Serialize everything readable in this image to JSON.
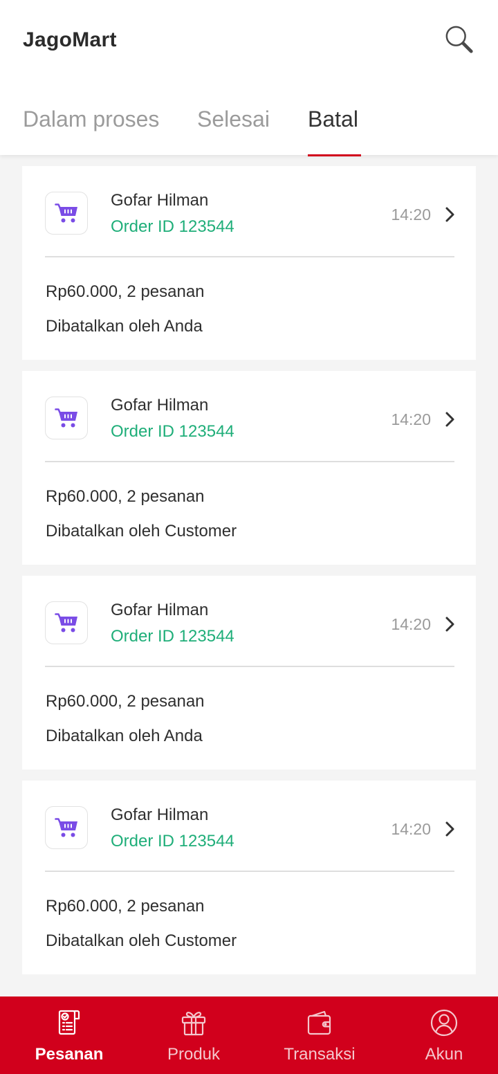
{
  "app": {
    "title": "JagoMart"
  },
  "header": {
    "search_icon": "search-icon"
  },
  "tabs": [
    {
      "label": "Dalam proses",
      "active": false
    },
    {
      "label": "Selesai",
      "active": false
    },
    {
      "label": "Batal",
      "active": true
    }
  ],
  "orders": [
    {
      "icon": "cart-icon",
      "customer": "Gofar Hilman",
      "order_id": "Order ID 123544",
      "time": "14:20",
      "summary": "Rp60.000, 2 pesanan",
      "status": "Dibatalkan oleh Anda"
    },
    {
      "icon": "cart-icon",
      "customer": "Gofar Hilman",
      "order_id": "Order ID 123544",
      "time": "14:20",
      "summary": "Rp60.000, 2 pesanan",
      "status": "Dibatalkan oleh Customer"
    },
    {
      "icon": "cart-icon",
      "customer": "Gofar Hilman",
      "order_id": "Order ID 123544",
      "time": "14:20",
      "summary": "Rp60.000, 2 pesanan",
      "status": "Dibatalkan oleh Anda"
    },
    {
      "icon": "cart-icon",
      "customer": "Gofar Hilman",
      "order_id": "Order ID 123544",
      "time": "14:20",
      "summary": "Rp60.000, 2 pesanan",
      "status": "Dibatalkan oleh Customer"
    }
  ],
  "bottom_nav": [
    {
      "label": "Pesanan",
      "icon": "orders-icon",
      "active": true
    },
    {
      "label": "Produk",
      "icon": "gift-icon",
      "active": false
    },
    {
      "label": "Transaksi",
      "icon": "wallet-icon",
      "active": false
    },
    {
      "label": "Akun",
      "icon": "account-icon",
      "active": false
    }
  ],
  "colors": {
    "brand": "#d1001c",
    "order_id": "#1fae79",
    "cart_icon": "#7a4ce6",
    "active_tab": "#333333",
    "inactive_tab": "#9b9b9b"
  }
}
